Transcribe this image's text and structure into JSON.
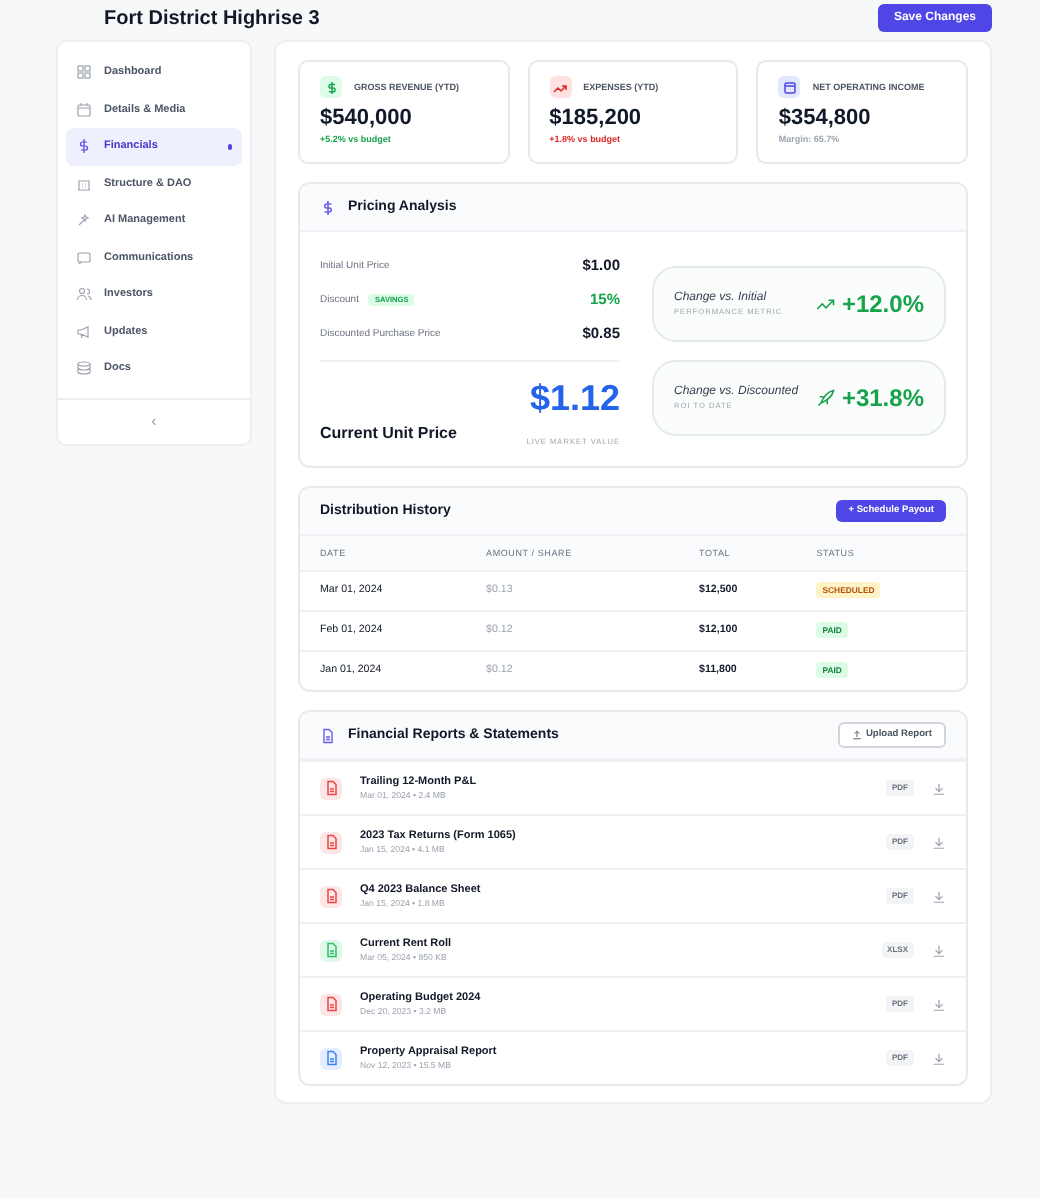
{
  "header": {
    "title": "Fort District Highrise 3",
    "save_button": "Save Changes"
  },
  "sidebar": {
    "items": [
      {
        "label": "Dashboard",
        "selected": false
      },
      {
        "label": "Details & Media",
        "selected": false
      },
      {
        "label": "Financials",
        "selected": true
      },
      {
        "label": "Structure & DAO",
        "selected": false
      },
      {
        "label": "AI Management",
        "selected": false
      },
      {
        "label": "Communications",
        "selected": false
      },
      {
        "label": "Investors",
        "selected": false
      },
      {
        "label": "Updates",
        "selected": false
      },
      {
        "label": "Docs",
        "selected": false
      }
    ],
    "collapse": "‹"
  },
  "stats": [
    {
      "label": "GROSS REVENUE (YTD)",
      "value": "$540,000",
      "note": "+5.2% vs budget",
      "kind": "revenue"
    },
    {
      "label": "EXPENSES (YTD)",
      "value": "$185,200",
      "note": "+1.8% vs budget",
      "kind": "expense"
    },
    {
      "label": "NET OPERATING INCOME",
      "value": "$354,800",
      "note": "Margin: 65.7%",
      "kind": "income"
    }
  ],
  "pricing": {
    "title": "Pricing Analysis",
    "rows": [
      {
        "label": "Initial Unit Price",
        "value": "$1.00",
        "kind": "plain"
      },
      {
        "label": "Discount",
        "badge": "SAVINGS",
        "value": "15%",
        "kind": "discount"
      },
      {
        "label": "Discounted Purchase Price",
        "value": "$0.85",
        "kind": "plain"
      }
    ],
    "current": {
      "label": "Current Unit Price",
      "value": "$1.12",
      "caption": "LIVE MARKET VALUE"
    },
    "metrics": [
      {
        "title": "Change vs. Initial",
        "caption": "PERFORMANCE METRIC",
        "value": "+12.0%"
      },
      {
        "title": "Change vs. Discounted",
        "caption": "ROI TO DATE",
        "value": "+31.8%"
      }
    ]
  },
  "distribution": {
    "title": "Distribution History",
    "button": "+ Schedule Payout",
    "columns": [
      "DATE",
      "AMOUNT / SHARE",
      "TOTAL",
      "STATUS"
    ],
    "rows": [
      {
        "date": "Mar 01, 2024",
        "amount": "$0.13",
        "total": "$12,500",
        "status": "SCHEDULED",
        "kind": "scheduled"
      },
      {
        "date": "Feb 01, 2024",
        "amount": "$0.12",
        "total": "$12,100",
        "status": "PAID",
        "kind": "paid"
      },
      {
        "date": "Jan 01, 2024",
        "amount": "$0.12",
        "total": "$11,800",
        "status": "PAID",
        "kind": "paid"
      }
    ]
  },
  "reports": {
    "title": "Financial Reports & Statements",
    "button": "Upload Report",
    "items": [
      {
        "name": "Trailing 12-Month P&L",
        "meta": "Mar 01, 2024 • 2.4 MB",
        "type": "PDF",
        "color": "#ef4444"
      },
      {
        "name": "2023 Tax Returns (Form 1065)",
        "meta": "Jan 15, 2024 • 4.1 MB",
        "type": "PDF",
        "color": "#ef4444"
      },
      {
        "name": "Q4 2023 Balance Sheet",
        "meta": "Jan 15, 2024 • 1.8 MB",
        "type": "PDF",
        "color": "#ef4444"
      },
      {
        "name": "Current Rent Roll",
        "meta": "Mar 05, 2024 • 850 KB",
        "type": "XLSX",
        "color": "#22c55e"
      },
      {
        "name": "Operating Budget 2024",
        "meta": "Dec 20, 2023 • 3.2 MB",
        "type": "PDF",
        "color": "#ef4444"
      },
      {
        "name": "Property Appraisal Report",
        "meta": "Nov 12, 2023 • 15.5 MB",
        "type": "PDF",
        "color": "#3b82f6"
      }
    ]
  }
}
